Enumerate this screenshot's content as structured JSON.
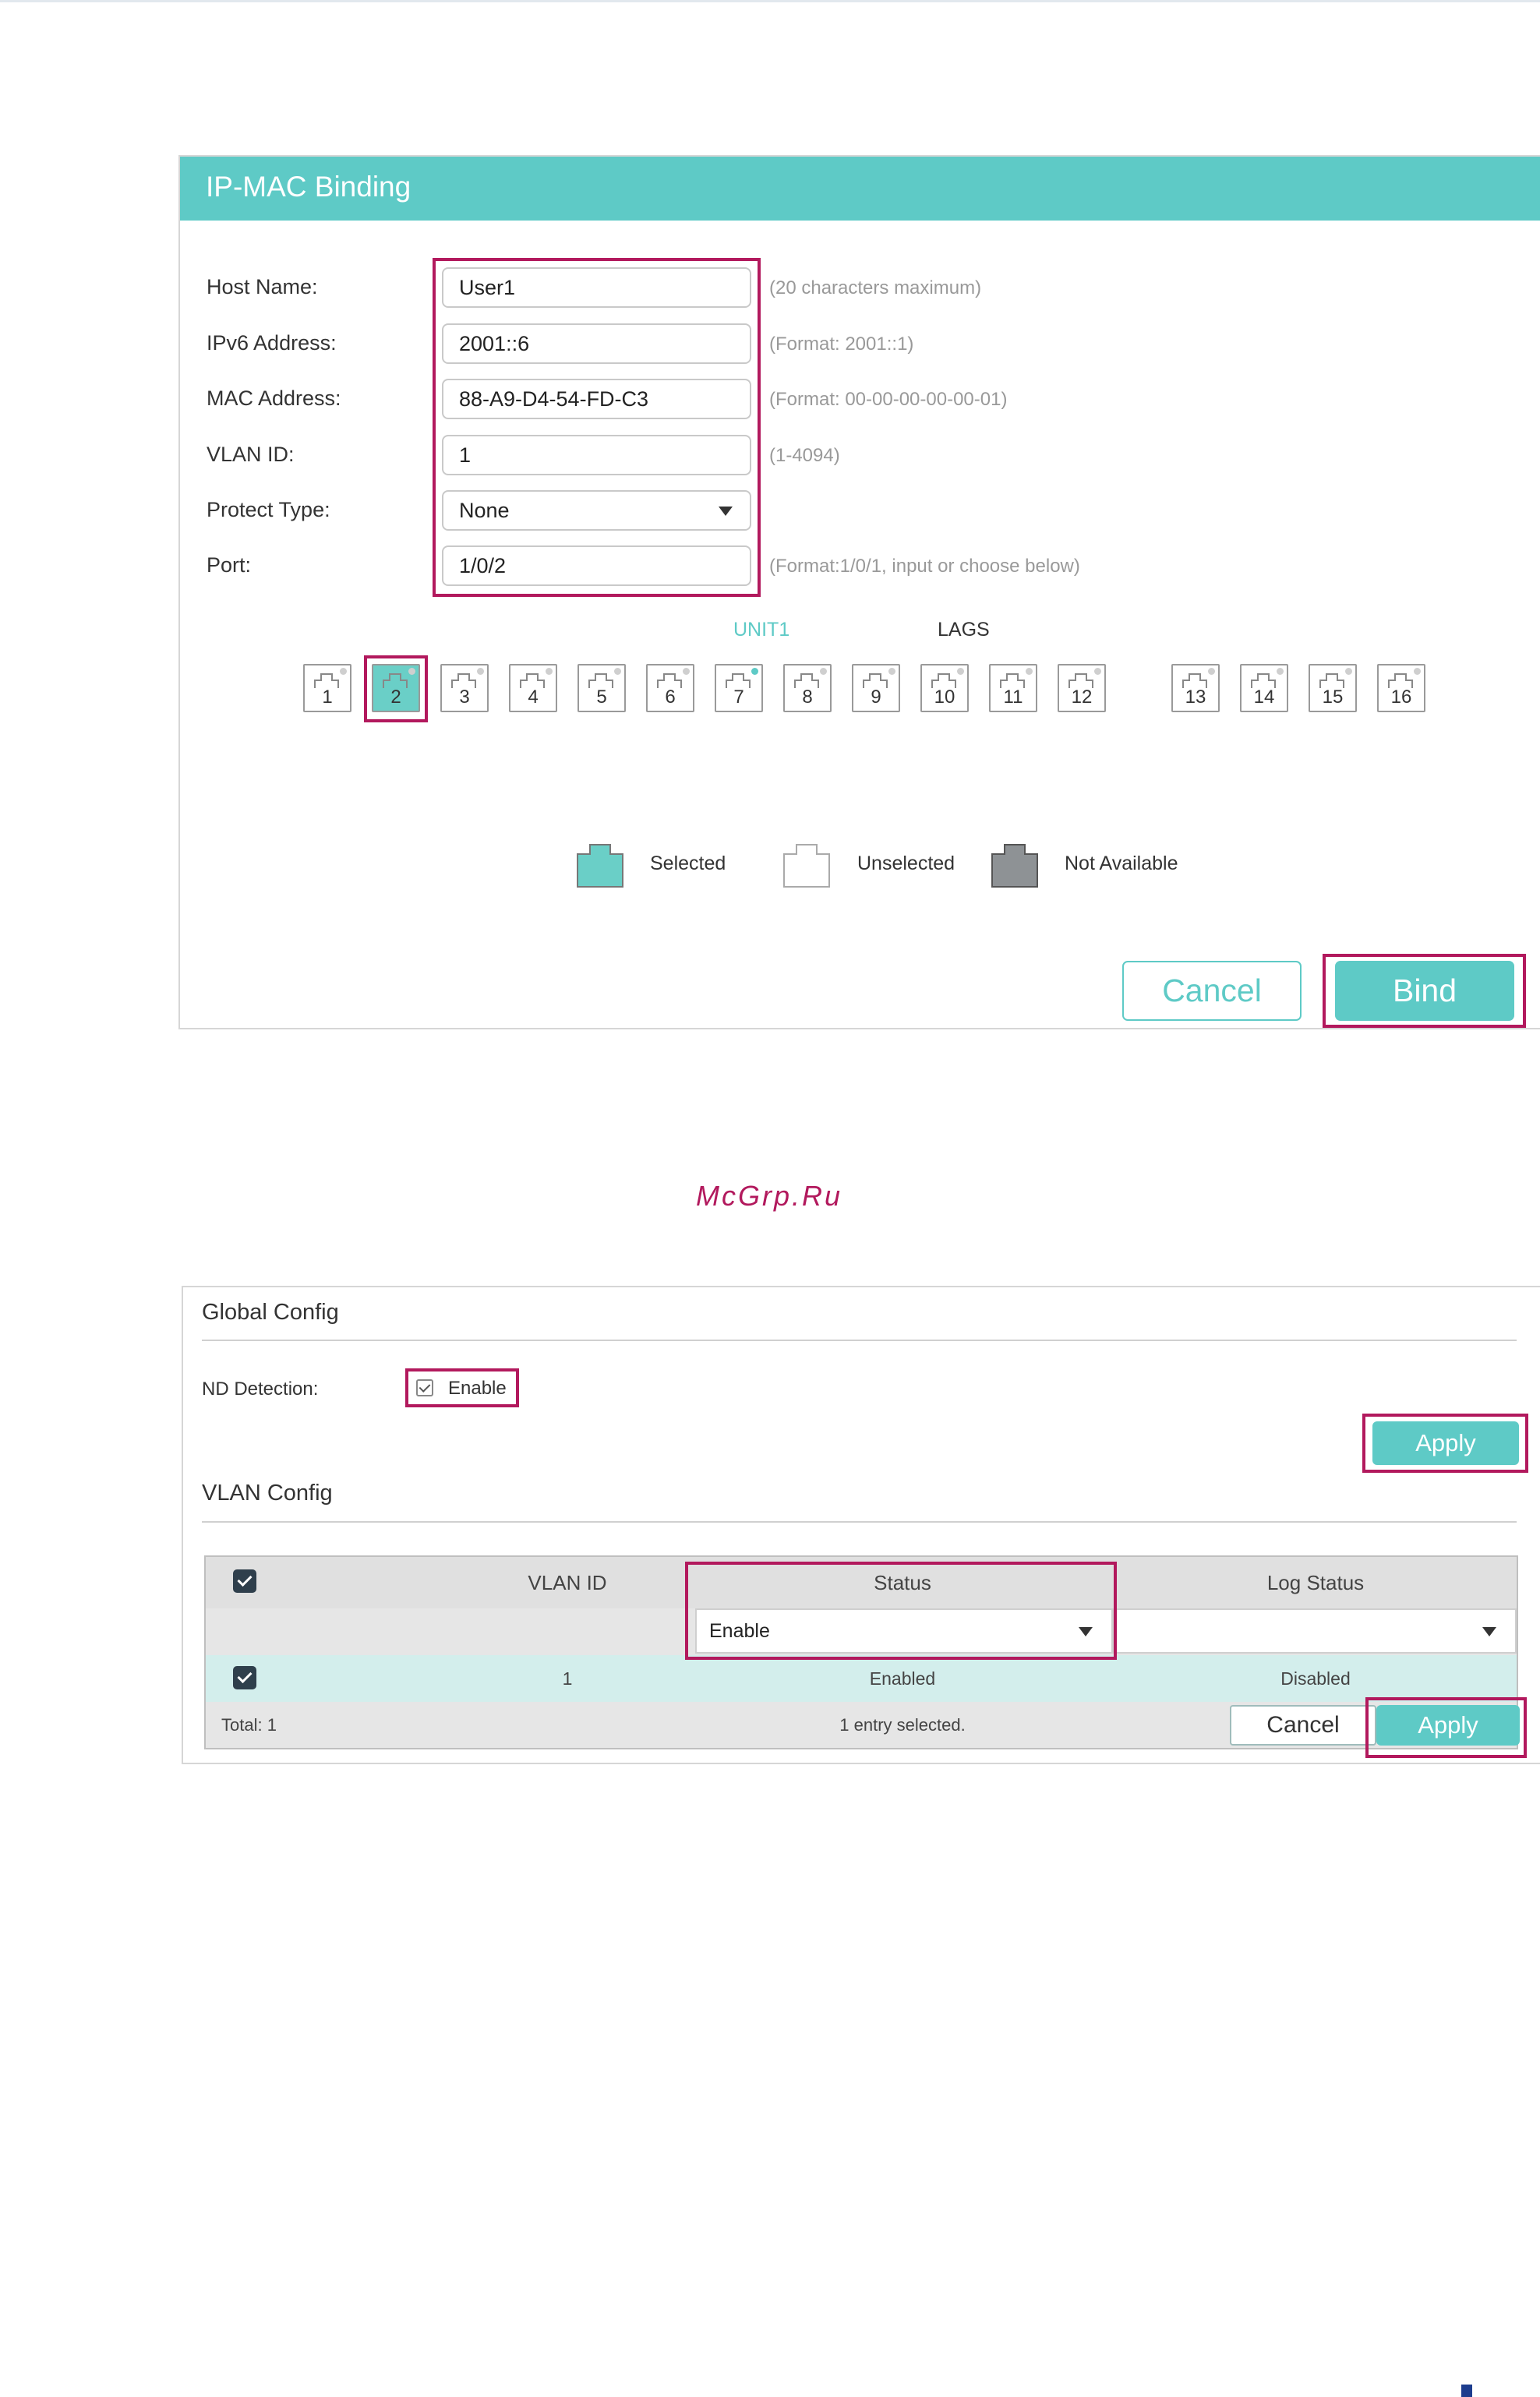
{
  "ip_mac_binding": {
    "title": "IP-MAC Binding",
    "fields": {
      "host_name": {
        "label": "Host Name:",
        "value": "User1",
        "hint": "(20 characters maximum)"
      },
      "ipv6_address": {
        "label": "IPv6 Address:",
        "value": "2001::6",
        "hint": "(Format: 2001::1)"
      },
      "mac_address": {
        "label": "MAC Address:",
        "value": "88-A9-D4-54-FD-C3",
        "hint": "(Format: 00-00-00-00-00-01)"
      },
      "vlan_id": {
        "label": "VLAN ID:",
        "value": "1",
        "hint": "(1-4094)"
      },
      "protect_type": {
        "label": "Protect Type:",
        "value": "None"
      },
      "port": {
        "label": "Port:",
        "value": "1/0/2",
        "hint": "(Format:1/0/1, input or choose below)"
      }
    },
    "tabs": {
      "unit1": "UNIT1",
      "lags": "LAGS"
    },
    "ports": [
      "1",
      "2",
      "3",
      "4",
      "5",
      "6",
      "7",
      "8",
      "9",
      "10",
      "11",
      "12",
      "13",
      "14",
      "15",
      "16"
    ],
    "selected_port": "2",
    "legend": {
      "selected": "Selected",
      "unselected": "Unselected",
      "not_available": "Not Available"
    },
    "buttons": {
      "cancel": "Cancel",
      "bind": "Bind"
    },
    "colors": {
      "accent": "#5ecac6",
      "highlight": "#b2195d"
    }
  },
  "watermark": "McGrp.Ru",
  "nd_detection": {
    "global_config": {
      "title": "Global Config",
      "nd_detection_label": "ND Detection:",
      "enable_label": "Enable",
      "enable_checked": true,
      "apply_label": "Apply"
    },
    "vlan_config": {
      "title": "VLAN Config",
      "columns": {
        "vlan_id": "VLAN ID",
        "status": "Status",
        "log_status": "Log Status"
      },
      "filter": {
        "status": "Enable",
        "log_status": ""
      },
      "rows": [
        {
          "vlan_id": "1",
          "status": "Enabled",
          "log_status": "Disabled"
        }
      ],
      "footer": {
        "total": "Total: 1",
        "selected": "1 entry selected.",
        "cancel": "Cancel",
        "apply": "Apply"
      }
    }
  }
}
